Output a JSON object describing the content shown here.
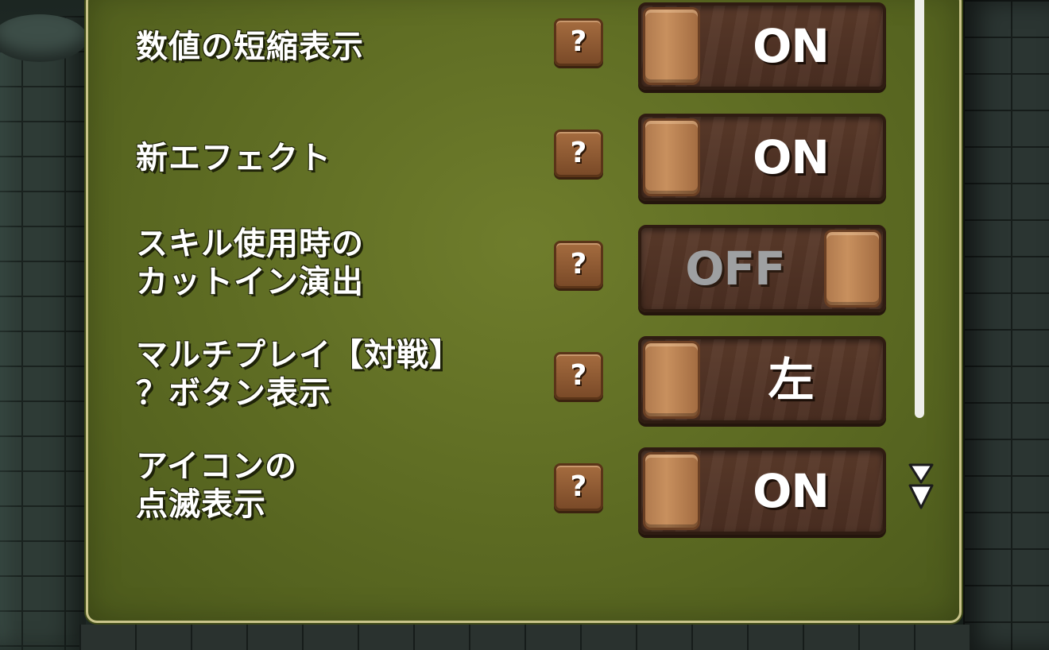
{
  "settings": {
    "rows": [
      {
        "label": "数値の短縮表示",
        "help": "?",
        "state": "ON"
      },
      {
        "label": "新エフェクト",
        "help": "?",
        "state": "ON"
      },
      {
        "label": "スキル使用時の\nカットイン演出",
        "help": "?",
        "state": "OFF"
      },
      {
        "label": "マルチプレイ【対戦】\n？ボタン表示",
        "help": "?",
        "state": "左"
      },
      {
        "label": "アイコンの\n点滅表示",
        "help": "?",
        "state": "ON"
      }
    ]
  },
  "colors": {
    "panel": "#5c6a22",
    "panel_border": "#c9c48a",
    "toggle_bg": "#4a2e21",
    "knob": "#c8905e",
    "off_text": "#9ea0a2"
  },
  "icons": {
    "help": "question-mark-icon",
    "scroll_more": "double-down-arrow-icon"
  }
}
